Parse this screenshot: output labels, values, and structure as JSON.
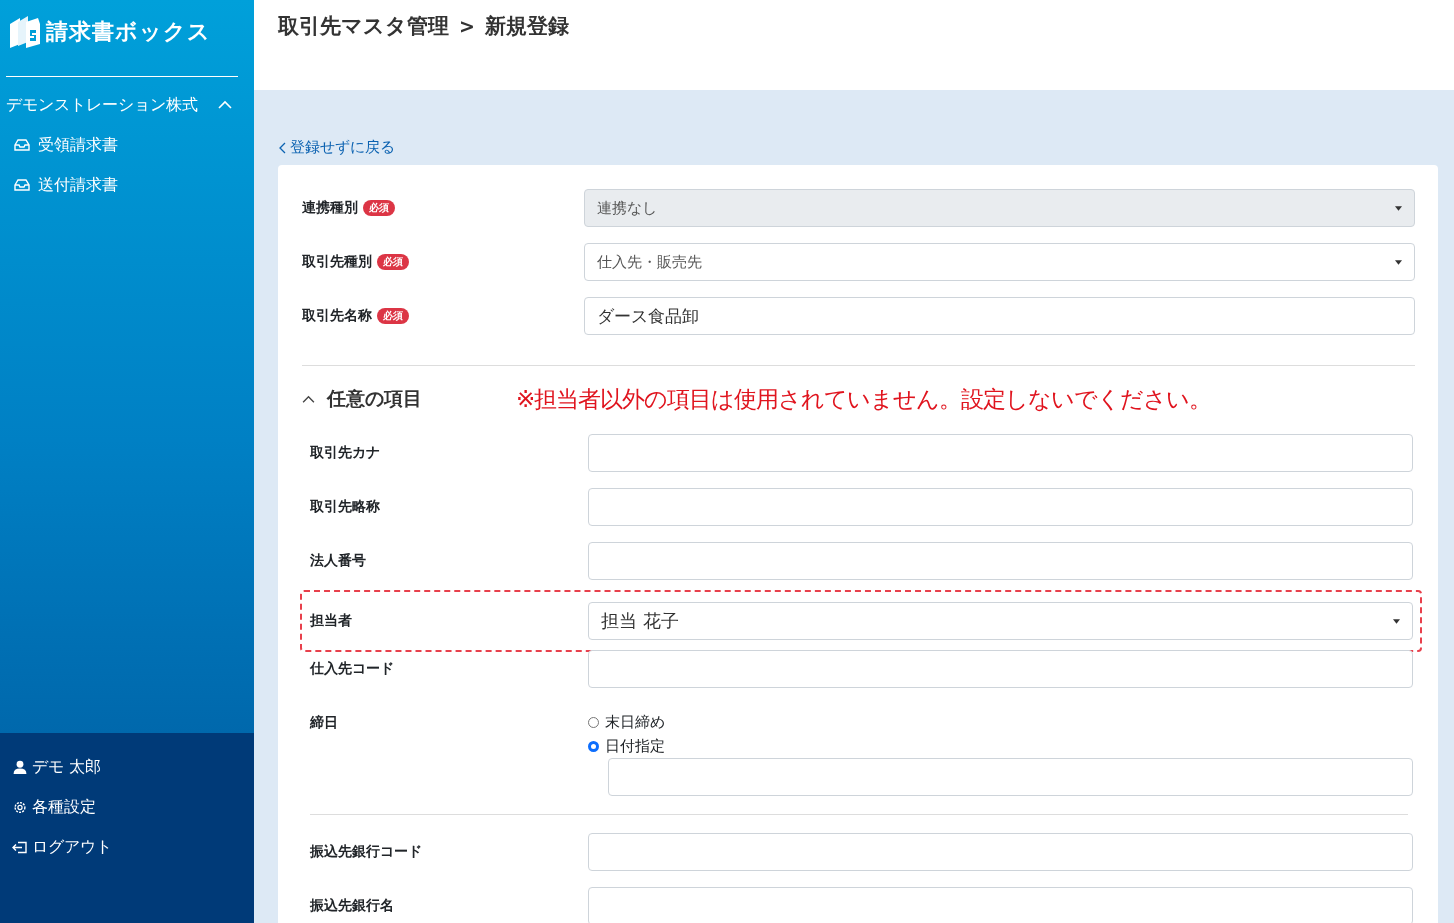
{
  "sidebar": {
    "logo": "請求書ボックス",
    "company": {
      "name": "デモンストレーション株式",
      "expanded": true
    },
    "nav_items": [
      {
        "label": "受領請求書",
        "selected": false
      },
      {
        "label": "送付請求書",
        "selected": false
      }
    ],
    "footer_items": [
      {
        "kind": "user",
        "label": "デモ 太郎"
      },
      {
        "kind": "settings",
        "label": "各種設定"
      },
      {
        "kind": "logout",
        "label": "ログアウト"
      }
    ]
  },
  "header": {
    "breadcrumb": [
      "取引先マスタ管理",
      "新規登録"
    ],
    "separator": ">"
  },
  "back_link": "登録せずに戻る",
  "required_fields": [
    {
      "label": "連携種別",
      "badge": "必須",
      "kind": "select",
      "value": "連携なし",
      "disabled": true
    },
    {
      "label": "取引先種別",
      "badge": "必須",
      "kind": "select",
      "value": "仕入先・販売先",
      "disabled": false
    },
    {
      "label": "取引先名称",
      "badge": "必須",
      "kind": "text",
      "value": "ダース食品卸",
      "disabled": false
    }
  ],
  "optional_section": {
    "title": "任意の項目",
    "expanded": true,
    "notice": "※担当者以外の項目は使用されていません。設定しないでください。"
  },
  "optional_fields": [
    {
      "label": "取引先カナ",
      "kind": "text",
      "highlighted": false
    },
    {
      "label": "取引先略称",
      "kind": "text",
      "highlighted": false
    },
    {
      "label": "法人番号",
      "kind": "text",
      "highlighted": false
    },
    {
      "label": "担当者",
      "kind": "select",
      "value": "担当 花子",
      "highlighted": true
    },
    {
      "label": "仕入先コード",
      "kind": "text",
      "highlighted": false
    },
    {
      "label": "締日",
      "kind": "radio",
      "highlighted": false,
      "options": [
        {
          "label": "末日締め",
          "selected": false
        },
        {
          "label": "日付指定",
          "selected": true
        }
      ]
    }
  ],
  "bank_fields": [
    {
      "label": "振込先銀行コード",
      "kind": "text",
      "highlighted": false
    },
    {
      "label": "振込先銀行名",
      "kind": "text",
      "highlighted": false
    }
  ]
}
